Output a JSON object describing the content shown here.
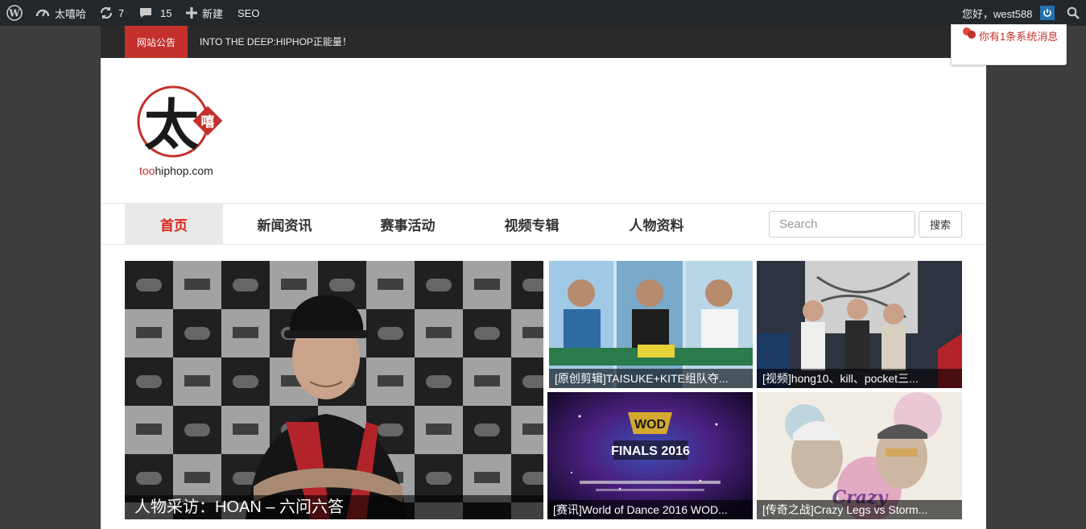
{
  "adminbar": {
    "site_name": "太嘻哈",
    "updates_count": "7",
    "comments_count": "15",
    "new_label": "新建",
    "seo_label": "SEO",
    "greeting": "您好，west588"
  },
  "notice": {
    "label": "网站公告",
    "text": "INTO THE DEEP:HIPHOP正能量！"
  },
  "popup": {
    "message": "你有1条系统消息"
  },
  "logo": {
    "domain_red": "too",
    "domain_rest": "hiphop.com",
    "glyph_main": "太",
    "glyph_side": "嘻"
  },
  "nav": {
    "items": [
      {
        "label": "首页",
        "active": true
      },
      {
        "label": "新闻资讯",
        "active": false
      },
      {
        "label": "赛事活动",
        "active": false
      },
      {
        "label": "视频专辑",
        "active": false
      },
      {
        "label": "人物资料",
        "active": false
      }
    ],
    "search_placeholder": "Search",
    "search_button": "搜索"
  },
  "featured": [
    {
      "caption": "人物采访：HOAN – 六问六答"
    },
    {
      "caption": "[原创剪辑]TAISUKE+KITE组队夺..."
    },
    {
      "caption": "[视频]hong10、kill、pocket三..."
    },
    {
      "caption": "[赛讯]World of Dance 2016 WOD..."
    },
    {
      "caption": "[传奇之战]Crazy Legs vs Storm..."
    }
  ],
  "colors": {
    "accent": "#c4302b",
    "adminbar": "#23282d",
    "page_bg": "#3d3d3d"
  }
}
